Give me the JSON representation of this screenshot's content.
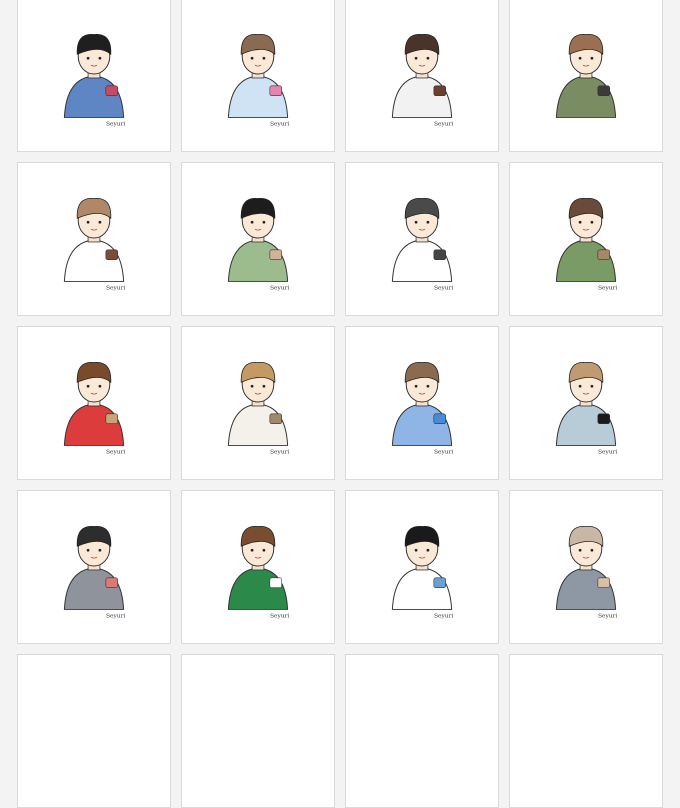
{
  "gallery": {
    "tiles": [
      {
        "signature": "Seyuri",
        "hair": "#1f1f1f",
        "shirt": "#5f86c4",
        "accent": "#c64b62",
        "icon": "glasses-portrait-icon"
      },
      {
        "signature": "Seyuri",
        "hair": "#8a6a50",
        "shirt": "#cfe3f4",
        "accent": "#e783b0",
        "icon": "sheep-plush-portrait-icon"
      },
      {
        "signature": "Seyuri",
        "hair": "#4a3328",
        "shirt": "#f2f2f2",
        "accent": "#6a4030",
        "icon": "sweater-portrait-icon"
      },
      {
        "signature": "",
        "hair": "#9b7050",
        "shirt": "#7a8d62",
        "accent": "#3b3b3b",
        "icon": "earmuffs-portrait-icon"
      },
      {
        "signature": "Seyuri",
        "hair": "#b08868",
        "shirt": "#ffffff",
        "accent": "#7a4c3a",
        "icon": "white-shirt-portrait-icon"
      },
      {
        "signature": "Seyuri",
        "hair": "#1d1d1d",
        "shirt": "#9cbc8e",
        "accent": "#d6b19a",
        "icon": "camo-jacket-portrait-icon"
      },
      {
        "signature": "Seyuri",
        "hair": "#4a4a4a",
        "shirt": "#ffffff",
        "accent": "#444444",
        "icon": "standing-figure-icon"
      },
      {
        "signature": "Seyuri",
        "hair": "#6a4a3a",
        "shirt": "#7a9a66",
        "accent": "#a48868",
        "icon": "arms-up-camo-icon"
      },
      {
        "signature": "Seyuri",
        "hair": "#7a4a2c",
        "shirt": "#dd3c3c",
        "accent": "#c9a47a",
        "icon": "boxing-gloves-portrait-icon"
      },
      {
        "signature": "Seyuri",
        "hair": "#c29a62",
        "shirt": "#f4f0ea",
        "accent": "#a1886c",
        "icon": "two-friends-portrait-icon"
      },
      {
        "signature": "Seyuri",
        "hair": "#8a6a50",
        "shirt": "#8fb4e6",
        "accent": "#4a8ad6",
        "icon": "plush-toy-portrait-icon"
      },
      {
        "signature": "Seyuri",
        "hair": "#c09a72",
        "shirt": "#b8ccd8",
        "accent": "#1a1a1a",
        "icon": "singer-with-paper-icon"
      },
      {
        "signature": "Seyuri",
        "hair": "#2d2d2d",
        "shirt": "#8f939c",
        "accent": "#d97b72",
        "icon": "brick-wall-duo-icon"
      },
      {
        "signature": "Seyuri",
        "hair": "#7a4c30",
        "shirt": "#2b8a4a",
        "accent": "#ffffff",
        "icon": "striped-sweater-portrait-icon"
      },
      {
        "signature": "Seyuri",
        "hair": "#1a1a1a",
        "shirt": "#ffffff",
        "accent": "#6aa0d4",
        "icon": "curly-hair-portrait-icon"
      },
      {
        "signature": "Seyuri",
        "hair": "#c9b6a4",
        "shirt": "#8e98a4",
        "accent": "#d8c0a8",
        "icon": "embrace-duo-icon"
      }
    ]
  }
}
